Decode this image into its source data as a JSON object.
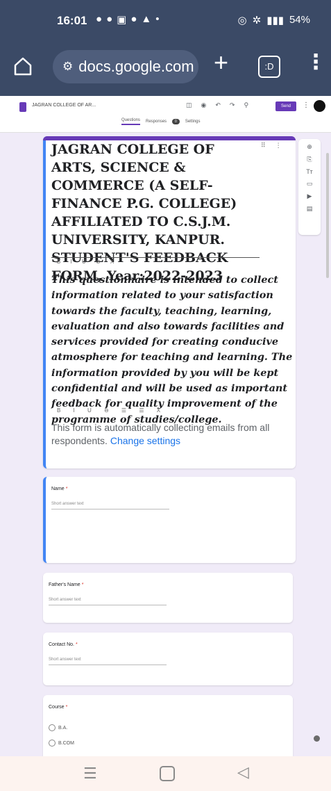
{
  "status_bar": {
    "time": "16:01",
    "battery": "54%",
    "signal": "▮▮▮"
  },
  "browser": {
    "url": "docs.google.com",
    "tabs_count": ":D"
  },
  "docs_header": {
    "doc_title": "JAGRAN COLLEGE OF AR...",
    "send_label": "Send",
    "tabs": {
      "questions": "Questions",
      "responses": "Responses",
      "responses_count": "0",
      "settings": "Settings"
    }
  },
  "form": {
    "title": "JAGRAN COLLEGE OF ARTS, SCIENCE & COMMERCE (A SELF-FINANCE P.G. COLLEGE) AFFILIATED TO C.S.J.M. UNIVERSITY, KANPUR. STUDENT'S FEEDBACK FORM, Year:2022-2023",
    "description": "This questionnaire is intended to collect information related to your satisfaction towards the faculty, teaching, learning, evaluation and also towards facilities and services provided for creating conducive atmosphere for teaching and learning. The information provided by you will be kept confidential and will be used as important feedback for quality improvement of the programme of studies/college.",
    "email_note": "This form is automatically collecting emails from all respondents.",
    "change_settings": "Change settings",
    "title_tools": "B I U ⊘ X",
    "desc_tools": "B I U ⊖ ☰ ☰ X"
  },
  "questions": [
    {
      "label": "Name",
      "placeholder": "Short answer text"
    },
    {
      "label": "Father's Name",
      "placeholder": "Short answer text"
    },
    {
      "label": "Contact No.",
      "placeholder": "Short answer text"
    },
    {
      "label": "Course",
      "options": [
        "B.A.",
        "B.COM"
      ]
    }
  ],
  "colors": {
    "system_bar": "#3b4a66",
    "forms_purple": "#673ab7",
    "active_blue": "#4285f4",
    "link_blue": "#1a73e8",
    "page_bg": "#f0ebf8"
  }
}
